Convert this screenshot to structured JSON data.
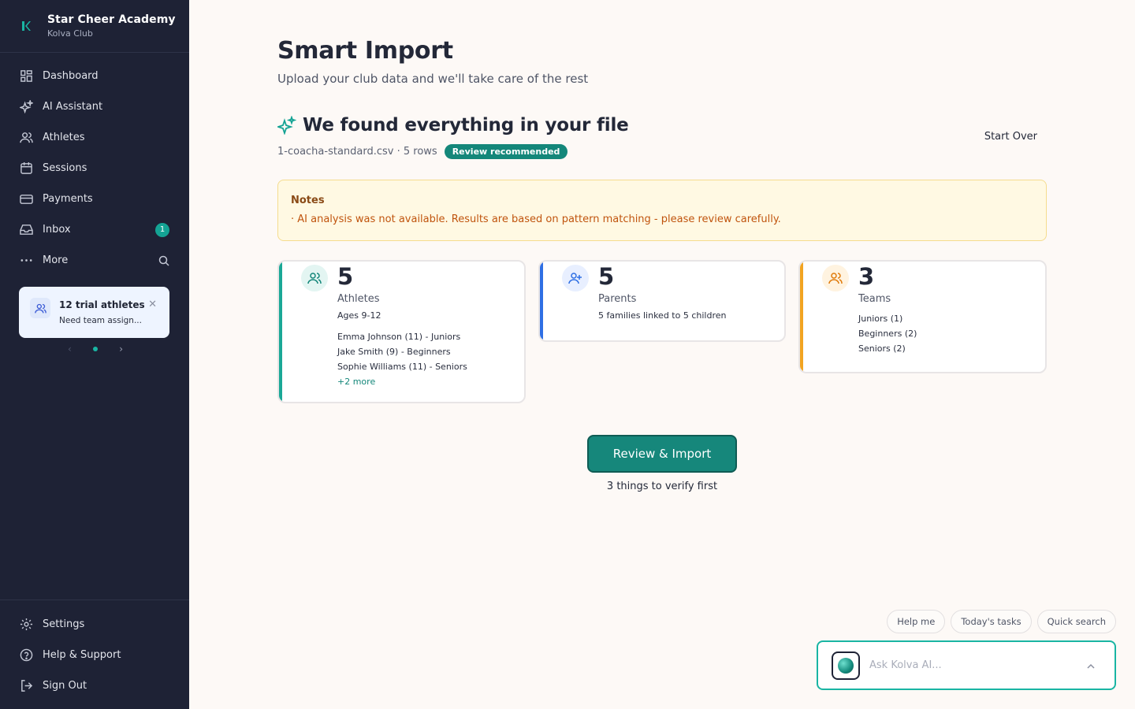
{
  "sidebar": {
    "club_name": "Star Cheer Academy",
    "club_sub": "Kolva Club",
    "nav": [
      {
        "label": "Dashboard",
        "icon": "dashboard-icon"
      },
      {
        "label": "AI Assistant",
        "icon": "sparkles-icon"
      },
      {
        "label": "Athletes",
        "icon": "users-icon"
      },
      {
        "label": "Sessions",
        "icon": "calendar-icon"
      },
      {
        "label": "Payments",
        "icon": "credit-card-icon"
      },
      {
        "label": "Inbox",
        "icon": "inbox-icon",
        "badge": "1"
      },
      {
        "label": "More",
        "icon": "more-icon"
      }
    ],
    "trial": {
      "title": "12 trial athletes",
      "subtitle": "Need team assign..."
    },
    "bottom_nav": [
      {
        "label": "Settings",
        "icon": "gear-icon"
      },
      {
        "label": "Help & Support",
        "icon": "help-icon"
      },
      {
        "label": "Sign Out",
        "icon": "sign-out-icon"
      }
    ]
  },
  "main": {
    "title": "Smart Import",
    "subtitle": "Upload your club data and we'll take care of the rest",
    "found_title": "We found everything in your file",
    "file_meta": "1-coacha-standard.csv · 5 rows",
    "badge": "Review recommended",
    "start_over": "Start Over",
    "notes": {
      "title": "Notes",
      "text": "· AI analysis was not available. Results are based on pattern matching - please review carefully."
    },
    "cards": {
      "athletes": {
        "count": "5",
        "label": "Athletes",
        "ages": "Ages 9-12",
        "items": [
          "Emma Johnson (11) - Juniors",
          "Jake Smith (9) - Beginners",
          "Sophie Williams (11) - Seniors"
        ],
        "more": "+2 more"
      },
      "parents": {
        "count": "5",
        "label": "Parents",
        "detail": "5 families linked to 5 children"
      },
      "teams": {
        "count": "3",
        "label": "Teams",
        "items": [
          "Juniors (1)",
          "Beginners (2)",
          "Seniors (2)"
        ]
      }
    },
    "import_button": "Review & Import",
    "verify_text": "3 things to verify first"
  },
  "assistant": {
    "chips": [
      "Help me",
      "Today's tasks",
      "Quick search"
    ],
    "placeholder": "Ask Kolva AI..."
  },
  "colors": {
    "sidebar_bg": "#1e2235",
    "accent": "#14a394",
    "athletes_stripe": "#1aa896",
    "parents_stripe": "#2f6fe4",
    "teams_stripe": "#f2a421",
    "notes_bg": "#fff9e3"
  }
}
